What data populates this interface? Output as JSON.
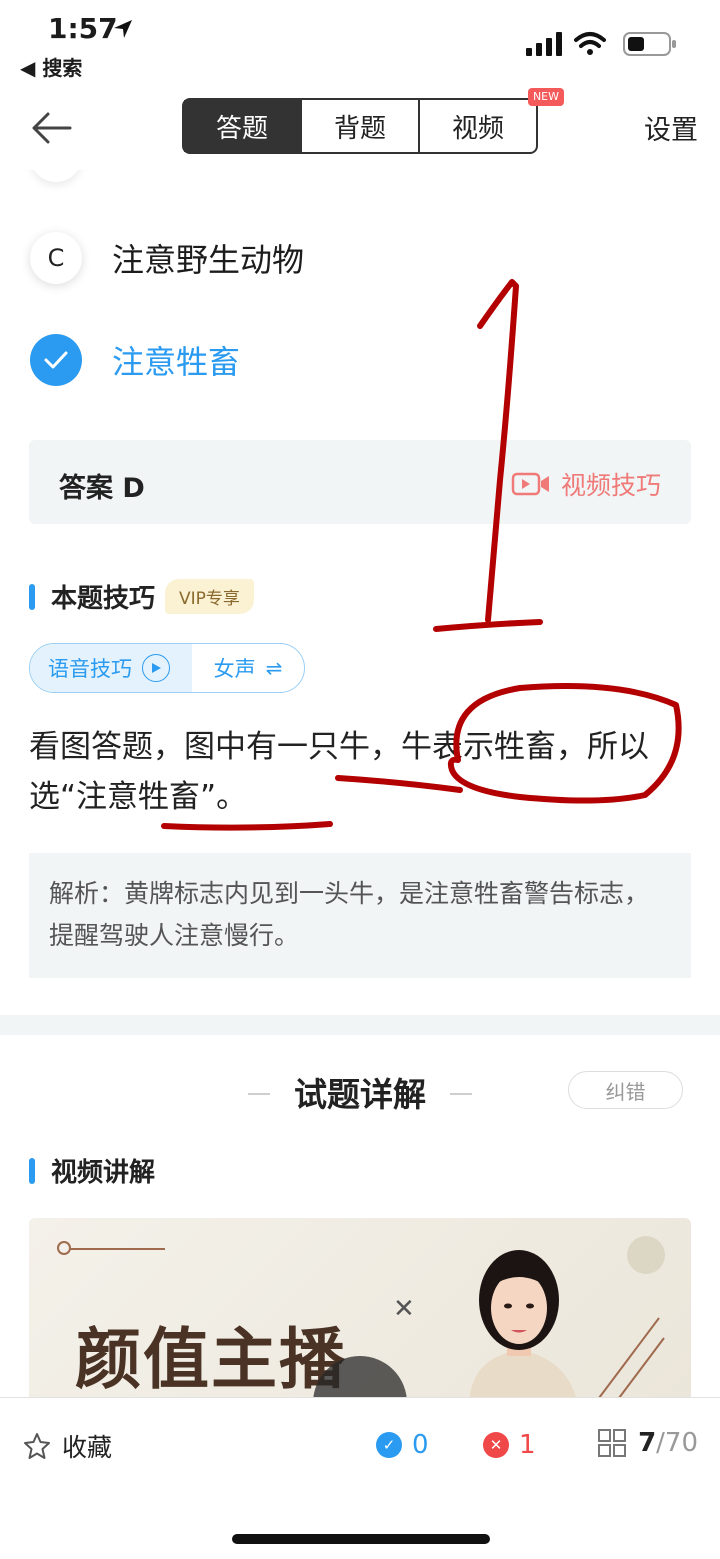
{
  "status_bar": {
    "time": "1:57",
    "back_app": "◀ 搜索"
  },
  "header": {
    "tabs": [
      {
        "label": "答题",
        "active": true
      },
      {
        "label": "背题",
        "active": false
      },
      {
        "label": "视频",
        "active": false,
        "badge": "NEW"
      }
    ],
    "settings_label": "设置"
  },
  "options": [
    {
      "letter": "C",
      "text": "注意野生动物",
      "selected": false
    },
    {
      "letter": "",
      "text": "注意牲畜",
      "selected": true
    }
  ],
  "answer": {
    "label": "答案 D",
    "video_tip": "视频技巧"
  },
  "skill": {
    "title": "本题技巧",
    "vip_badge": "VIP专享",
    "voice_label": "语音技巧",
    "voice_gender": "女声",
    "tip_text": "看图答题，图中有一只牛，牛表示牲畜，所以选“注意牲畜”。",
    "analysis": "解析：黄牌标志内见到一头牛，是注意牲畜警告标志，提醒驾驶人注意慢行。"
  },
  "detail": {
    "title": "试题详解",
    "correct_button": "纠错",
    "video_section": "视频讲解",
    "thumb_title": "颜值主播"
  },
  "bottom_bar": {
    "favorite_label": "收藏",
    "correct_count": "0",
    "wrong_count": "1",
    "current": "7",
    "total": "/70"
  },
  "colors": {
    "accent": "#2a9bf0",
    "error": "#f04848",
    "ink": "#b30000",
    "video_tip": "#f07a78"
  }
}
